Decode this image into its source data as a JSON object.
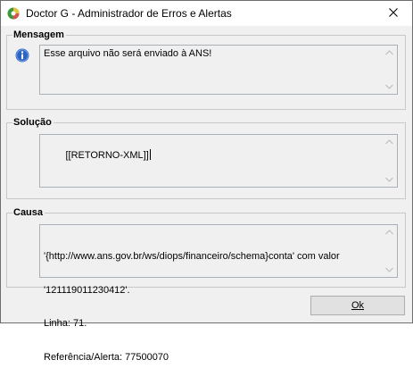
{
  "window": {
    "title": "Doctor G - Administrador de Erros e Alertas",
    "app_icon": "app-logo-icon",
    "close_icon": "close-icon"
  },
  "mensagem": {
    "label": "Mensagem",
    "icon": "info-icon",
    "text": "Esse arquivo não será enviado à ANS!"
  },
  "solucao": {
    "label": "Solução",
    "text": "[[RETORNO-XML]]"
  },
  "causa": {
    "label": "Causa",
    "line1": "'{http://www.ans.gov.br/ws/diops/financeiro/schema}conta' com valor",
    "line2": "'121119011230412'.",
    "line3": "Linha: 71.",
    "line4": "Referência/Alerta: 77500070"
  },
  "footer": {
    "ok_label": "Ok"
  },
  "colors": {
    "info_blue": "#2a64c0",
    "window_bg": "#f0f0f0"
  }
}
